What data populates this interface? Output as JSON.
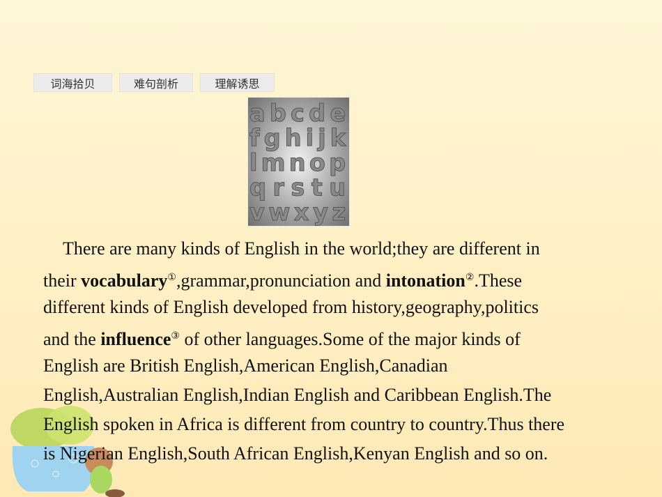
{
  "tabs": [
    "词海拾贝",
    "难句剖析",
    "理解诱思"
  ],
  "image": {
    "letters": [
      "abcde",
      "fghijk",
      "lmnop",
      "qrstu",
      "vwxyz"
    ]
  },
  "passage": {
    "l1": "There are many kinds of English in the world;they are different in",
    "l2a": "their ",
    "l2b": "vocabulary",
    "l2c": "①",
    "l2d": ",grammar,pronunciation and ",
    "l2e": "intonation",
    "l2f": "②",
    "l2g": ".These",
    "l3": "different kinds of English developed from history,geography,politics",
    "l4a": "and the ",
    "l4b": "influence",
    "l4c": "③",
    "l4d": " of other languages.Some of the major kinds of",
    "l5": "English are British English,American English,Canadian",
    "l6": "English,Australian English,Indian English and Caribbean English.The",
    "l7": "English spoken in Africa is different from country to country.Thus there",
    "l8": "is Nigerian English,South African English,Kenyan English and so on."
  }
}
